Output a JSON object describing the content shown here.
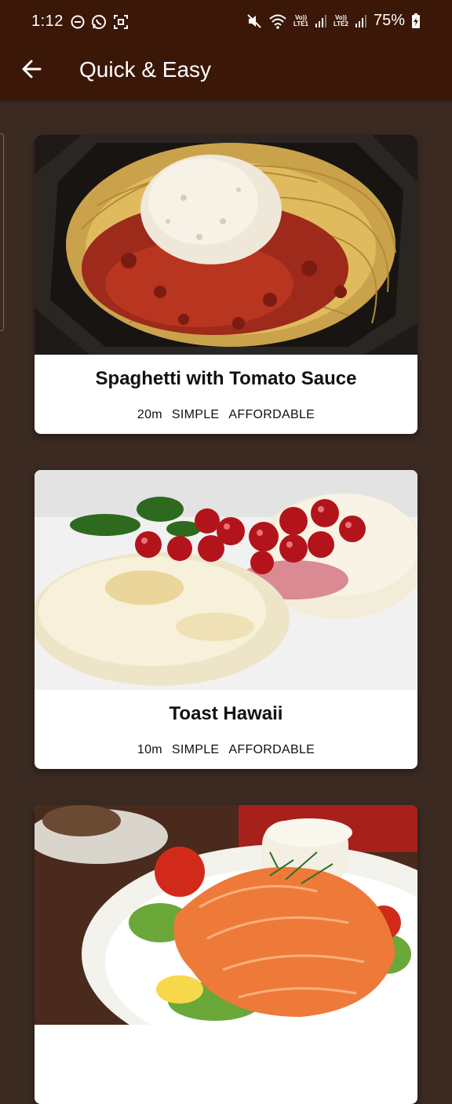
{
  "status_bar": {
    "time": "1:12",
    "battery": "75%",
    "sim1": "LTE1",
    "sim2": "LTE2",
    "volte": "Vo))"
  },
  "app_bar": {
    "title": "Quick & Easy"
  },
  "meals": [
    {
      "name": "Spaghetti with Tomato Sauce",
      "duration": "20m",
      "complexity": "SIMPLE",
      "affordability": "AFFORDABLE"
    },
    {
      "name": "Toast Hawaii",
      "duration": "10m",
      "complexity": "SIMPLE",
      "affordability": "AFFORDABLE"
    },
    {
      "name": "",
      "duration": "",
      "complexity": "",
      "affordability": ""
    }
  ],
  "colors": {
    "app_bar": "#3b1707",
    "background": "#3a2a22",
    "card": "#ffffff"
  }
}
